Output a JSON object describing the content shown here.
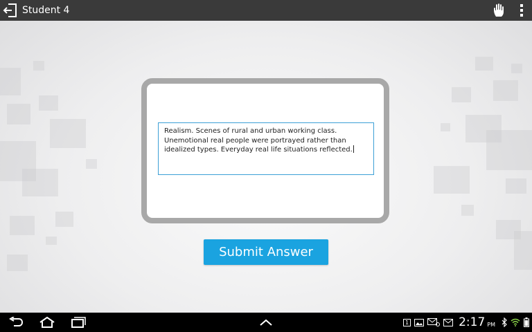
{
  "app": {
    "title": "Student 4"
  },
  "answer": {
    "text": "Realism. Scenes of rural and urban working class. Unemotional real people were portrayed rather than idealized types. Everyday real life situations reflected."
  },
  "actions": {
    "submit_label": "Submit Answer"
  },
  "status_bar": {
    "notification_count": "1",
    "time": "2:17",
    "ampm": "PM"
  },
  "icons": {
    "exit": "exit-icon",
    "hand": "raise-hand-icon",
    "overflow": "overflow-menu-icon",
    "back": "back-icon",
    "home": "home-icon",
    "recent": "recent-apps-icon",
    "up": "up-chevron-icon"
  },
  "colors": {
    "accent": "#1aa3e0",
    "topbar": "#3a3a3a",
    "card_border": "#a8a8a8",
    "input_border": "#3b9fd6"
  }
}
